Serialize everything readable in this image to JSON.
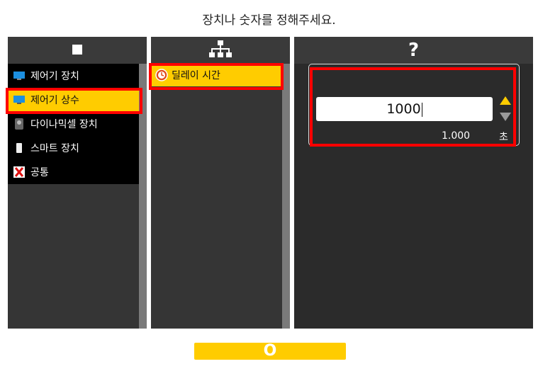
{
  "prompt": "장치나 숫자를 정해주세요.",
  "left_panel": {
    "header_icon": "stop-square-icon",
    "items": [
      {
        "label": "제어기 장치",
        "icon": "monitor-icon"
      },
      {
        "label": "제어기 상수",
        "icon": "monitor-icon",
        "selected": true
      },
      {
        "label": "다이나믹셀 장치",
        "icon": "dynamixel-icon"
      },
      {
        "label": "스마트 장치",
        "icon": "smartphone-icon"
      },
      {
        "label": "공통",
        "icon": "x-mark-icon"
      }
    ]
  },
  "middle_panel": {
    "header_icon": "hierarchy-icon",
    "items": [
      {
        "label": "딜레이 시간",
        "icon": "clock-icon",
        "selected": true
      }
    ]
  },
  "right_panel": {
    "header_label": "?",
    "value": "1000",
    "seconds_value": "1.000",
    "unit": "초"
  },
  "ok_button": {
    "label": "O"
  },
  "colors": {
    "accent": "#ffcc00",
    "highlight": "#ff0000",
    "panel": "#3a3a3a"
  }
}
